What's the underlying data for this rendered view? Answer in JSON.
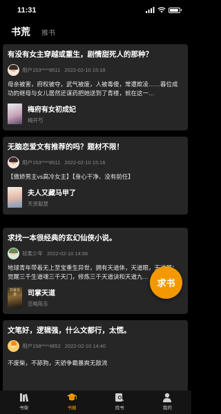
{
  "status_bar": {
    "time": "11:31"
  },
  "top_tabs": {
    "active": "书荒",
    "inactive": "推书"
  },
  "posts": [
    {
      "title": "有没有女主穿越或重生，剧情甜死人的那种？",
      "user": "用户153****8511",
      "time": "2022-02-10 15:18",
      "body": "母亲被害，府权被夺，武气被废，人被毒傻，常遭欺凌……暮位成功的继母与女儿居然还谋药把她送到了青楼，就在这一…",
      "book_title": "梅府有女初成妃",
      "book_author": "梅开芍"
    },
    {
      "title": "无脑恋爱文有推荐的吗？题材不限！",
      "user": "用户153****8511",
      "time": "2022-02-10 15:16",
      "body": "【傲娇男主vs高冷女主】【身心干净、没有前任】",
      "book_title": "夫人又藏马甲了",
      "book_author": "天资聪慧"
    },
    {
      "title": "求找一本很经典的玄幻仙侠小说。",
      "user": "轻柔少年",
      "time": "2022-02-10 14:56",
      "body": "地球青年带着无上至宝重生异世，拥有天道体，天道眼，天道翼；觉醒三千生道魂三千天门，修炼三千天道诀和天道九…",
      "book_title": "司掌天道",
      "book_author": "范略陈东"
    },
    {
      "title": "文笔好，逻辑强，什么文都行，太慌。",
      "user": "用户158****4852",
      "time": "2022-02-10 14:40",
      "body": "不废柴，不舔狗，天骄争霸暴爽无敌流"
    }
  ],
  "fab_label": "求书",
  "bottom_nav": [
    {
      "label": "书架",
      "icon": "bookshelf-icon"
    },
    {
      "label": "书圈",
      "icon": "graduation-cap-icon"
    },
    {
      "label": "找书",
      "icon": "find-book-icon"
    },
    {
      "label": "我的",
      "icon": "person-icon"
    }
  ],
  "colors": {
    "accent": "#f39800",
    "background": "#000000",
    "card": "#262626",
    "muted": "#8a8a8a"
  }
}
